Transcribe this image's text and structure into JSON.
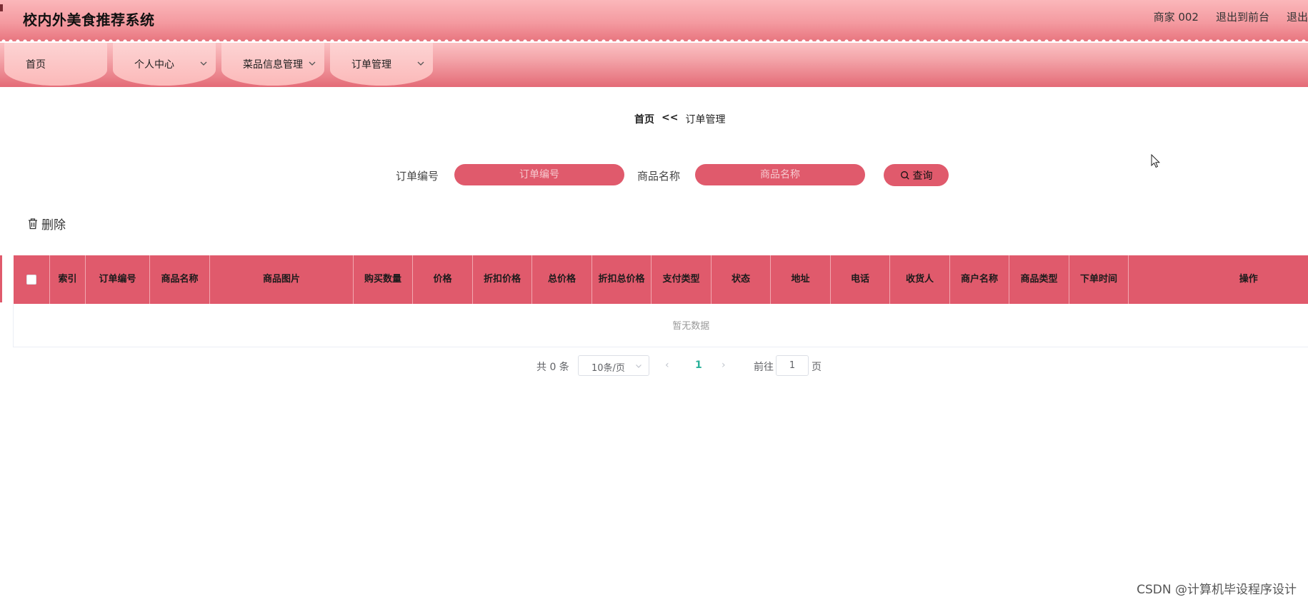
{
  "header": {
    "title": "校内外美食推荐系统",
    "user": "商家 002",
    "exit_front": "退出到前台",
    "exit": "退出"
  },
  "nav": {
    "items": [
      {
        "label": "首页",
        "has_dropdown": false
      },
      {
        "label": "个人中心",
        "has_dropdown": true
      },
      {
        "label": "菜品信息管理",
        "has_dropdown": true
      },
      {
        "label": "订单管理",
        "has_dropdown": true
      }
    ]
  },
  "breadcrumb": {
    "home": "首页",
    "separator": "<<",
    "current": "订单管理"
  },
  "search": {
    "order_no_label": "订单编号",
    "order_no_placeholder": "订单编号",
    "goods_name_label": "商品名称",
    "goods_name_placeholder": "商品名称",
    "query_label": "查询"
  },
  "actions": {
    "delete_label": "删除"
  },
  "table": {
    "columns": [
      "索引",
      "订单编号",
      "商品名称",
      "商品图片",
      "购买数量",
      "价格",
      "折扣价格",
      "总价格",
      "折扣总价格",
      "支付类型",
      "状态",
      "地址",
      "电话",
      "收货人",
      "商户名称",
      "商品类型",
      "下单时间",
      "操作"
    ],
    "empty_text": "暂无数据"
  },
  "pagination": {
    "total_text": "共 0 条",
    "page_size": "10条/页",
    "current_page": "1",
    "goto_label": "前往",
    "goto_value": "1",
    "page_unit": "页"
  },
  "watermark": "CSDN @计算机毕设程序设计",
  "colors": {
    "accent": "#e05a6c",
    "page_active": "#2bb19a"
  }
}
